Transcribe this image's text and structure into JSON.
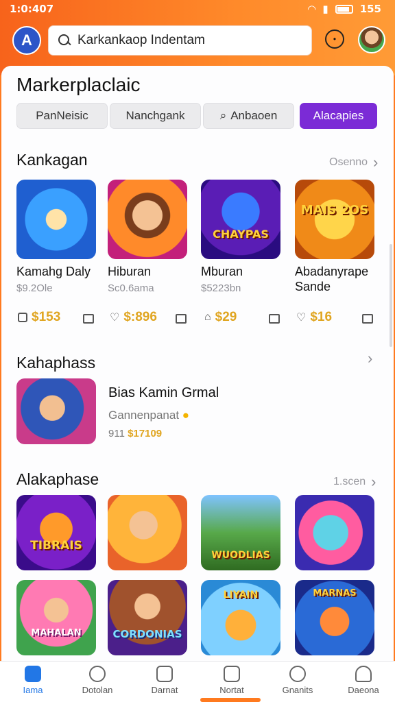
{
  "status": {
    "time": "1:0:407",
    "right": "155"
  },
  "search": {
    "placeholder": "Karkankaop Indentam"
  },
  "page_title": "Markerplaclaic",
  "segments": [
    "PanNeisic",
    "Nanchgank",
    "Anbaoen",
    "Alacapies"
  ],
  "section1": {
    "title": "Kankagan",
    "more": "Osenno",
    "games": [
      {
        "name": "Kamahg Daly",
        "sub": "$9.2Ole",
        "price": "$153",
        "art": ""
      },
      {
        "name": "Hiburan",
        "sub": "Sc0.6ama",
        "price": "$:896",
        "art": ""
      },
      {
        "name": "Mburan",
        "sub": "$5223bn",
        "price": "$29",
        "art": "CHAYPAS"
      },
      {
        "name": "Abadanyrape Sande",
        "sub": "",
        "price": "$16",
        "art": "MAIS 2OS"
      }
    ]
  },
  "section2": {
    "title": "Kahaphass",
    "featured": {
      "name": "Bias Kamin Grmal",
      "sub": "Gannenpanat",
      "price_prefix": "911",
      "price": "$17109"
    }
  },
  "section3": {
    "title": "Alakaphase",
    "more": "1.scen",
    "row1_art": [
      "TIBRAIS",
      "",
      "WUODLIAS",
      ""
    ],
    "row2_art": [
      "MAHALAN",
      "CORDONIAS",
      "LIYAIN",
      "MARNAS"
    ]
  },
  "nav": [
    "Iama",
    "Dotolan",
    "Darnat",
    "Nortat",
    "Gnanits",
    "Daeona"
  ],
  "colors": {
    "accent": "#7b2bd6",
    "orange": "#ff7a1f",
    "price": "#e0a520",
    "nav_active": "#2277e6"
  }
}
